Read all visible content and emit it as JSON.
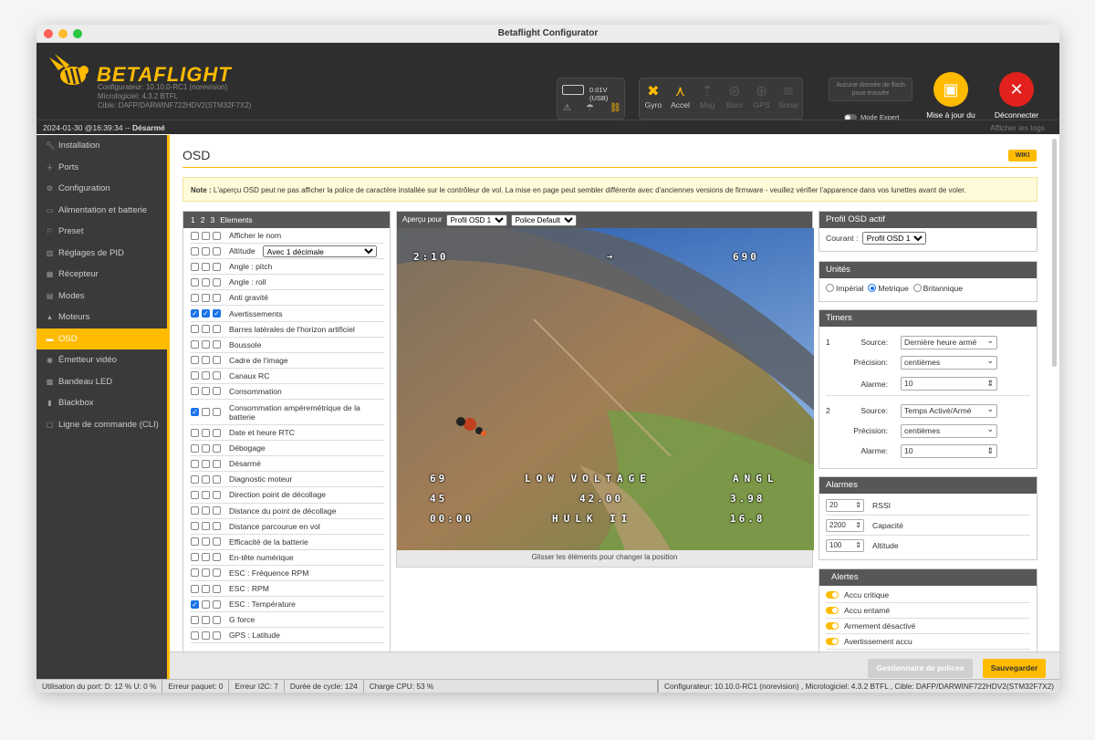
{
  "window": {
    "title": "Betaflight Configurator"
  },
  "header": {
    "brand": "BETAFLIGHT",
    "configurator": "Configurateur: 10.10.0-RC1 (norevision)",
    "firmware": "Micrologiciel: 4.3.2 BTFL",
    "target": "Cible: DAFP/DARWINF722HDV2(STM32F7X2)",
    "battery": "0.01V (USB)",
    "sensors": [
      {
        "label": "Gyro",
        "icon": "gyro-icon",
        "active": true
      },
      {
        "label": "Accel",
        "icon": "accel-icon",
        "active": true
      },
      {
        "label": "Mag",
        "icon": "mag-icon",
        "active": false
      },
      {
        "label": "Baro",
        "icon": "baro-icon",
        "active": false
      },
      {
        "label": "GPS",
        "icon": "gps-icon",
        "active": false
      },
      {
        "label": "Sonar",
        "icon": "sonar-icon",
        "active": false
      }
    ],
    "flash_line1": "Aucune donnée de flash",
    "flash_line2": "puce trouvée",
    "expert_mode": "Mode Expert",
    "update_btn_line1": "Mise à jour du",
    "update_btn_line2": "micrologiciel",
    "disconnect_btn": "Déconnecter",
    "brand_color": "#ffbb00",
    "disconnect_color": "#e2211c"
  },
  "statusline": {
    "datetime": "2024-01-30 @16:39:34 -- ",
    "state": "Désarmé",
    "show_logs": "Afficher les logs"
  },
  "sidebar": {
    "items": [
      {
        "label": "Installation",
        "icon": "wrench-icon"
      },
      {
        "label": "Ports",
        "icon": "plug-icon"
      },
      {
        "label": "Configuration",
        "icon": "gear-icon"
      },
      {
        "label": "Alimentation et batterie",
        "icon": "battery-icon"
      },
      {
        "label": "Preset",
        "icon": "preset-icon"
      },
      {
        "label": "Réglages de PID",
        "icon": "pid-icon"
      },
      {
        "label": "Récepteur",
        "icon": "receiver-icon"
      },
      {
        "label": "Modes",
        "icon": "modes-icon"
      },
      {
        "label": "Moteurs",
        "icon": "motor-icon"
      },
      {
        "label": "OSD",
        "icon": "osd-icon",
        "active": true
      },
      {
        "label": "Émetteur vidéo",
        "icon": "vtx-icon"
      },
      {
        "label": "Bandeau LED",
        "icon": "led-icon"
      },
      {
        "label": "Blackbox",
        "icon": "blackbox-icon"
      },
      {
        "label": "Ligne de commande (CLI)",
        "icon": "cli-icon"
      }
    ]
  },
  "main": {
    "title": "OSD",
    "wiki": "WIKI",
    "note_bold": "Note :",
    "note_text": " L'aperçu OSD peut ne pas afficher la police de caractère installée sur le contrôleur de vol. La mise en page peut sembler différente avec d'anciennes versions de firmware - veuillez vérifier l'apparence dans vos lunettes avant de voler."
  },
  "elements": {
    "header": {
      "p1": "1",
      "p2": "2",
      "p3": "3",
      "title": "Elements"
    },
    "rows": [
      {
        "label": "Afficher le nom",
        "checks": [
          false,
          false,
          false
        ]
      },
      {
        "label": "Altitude",
        "checks": [
          false,
          false,
          false
        ],
        "select": "Avec 1 décimale"
      },
      {
        "label": "Angle : pitch",
        "checks": [
          false,
          false,
          false
        ]
      },
      {
        "label": "Angle : roll",
        "checks": [
          false,
          false,
          false
        ]
      },
      {
        "label": "Anti gravité",
        "checks": [
          false,
          false,
          false
        ]
      },
      {
        "label": "Avertissements",
        "checks": [
          true,
          true,
          true
        ]
      },
      {
        "label": "Barres latérales de l'horizon artificiel",
        "checks": [
          false,
          false,
          false
        ]
      },
      {
        "label": "Boussole",
        "checks": [
          false,
          false,
          false
        ]
      },
      {
        "label": "Cadre de l'image",
        "checks": [
          false,
          false,
          false
        ]
      },
      {
        "label": "Canaux RC",
        "checks": [
          false,
          false,
          false
        ]
      },
      {
        "label": "Consommation",
        "checks": [
          false,
          false,
          false
        ]
      },
      {
        "label": "Consommation ampèremétrique de la batterie",
        "checks": [
          true,
          false,
          false
        ],
        "tall": true
      },
      {
        "label": "Date et heure RTC",
        "checks": [
          false,
          false,
          false
        ]
      },
      {
        "label": "Débogage",
        "checks": [
          false,
          false,
          false
        ]
      },
      {
        "label": "Désarmé",
        "checks": [
          false,
          false,
          false
        ]
      },
      {
        "label": "Diagnostic moteur",
        "checks": [
          false,
          false,
          false
        ]
      },
      {
        "label": "Direction point de décollage",
        "checks": [
          false,
          false,
          false
        ]
      },
      {
        "label": "Distance du point de décollage",
        "checks": [
          false,
          false,
          false
        ]
      },
      {
        "label": "Distance parcourue en vol",
        "checks": [
          false,
          false,
          false
        ]
      },
      {
        "label": "Efficacité de la batterie",
        "checks": [
          false,
          false,
          false
        ]
      },
      {
        "label": "En-tête numérique",
        "checks": [
          false,
          false,
          false
        ]
      },
      {
        "label": "ESC : Fréquence RPM",
        "checks": [
          false,
          false,
          false
        ]
      },
      {
        "label": "ESC : RPM",
        "checks": [
          false,
          false,
          false
        ]
      },
      {
        "label": "ESC : Température",
        "checks": [
          true,
          false,
          false
        ]
      },
      {
        "label": "G force",
        "checks": [
          false,
          false,
          false
        ]
      },
      {
        "label": "GPS : Latitude",
        "checks": [
          false,
          false,
          false
        ]
      }
    ]
  },
  "preview": {
    "label": "Aperçu pour",
    "profile": "Profil OSD 1",
    "font": "Police Default",
    "footer": "Glisser les éléments pour changer la position",
    "osd": {
      "timer": "2:10",
      "mah": "690",
      "warning": "LOW VOLTAGE",
      "angl": "ANGL",
      "sats": "69",
      "temp": "45",
      "voltage": "42.00",
      "cell": "3.98",
      "fly_time": "00:00",
      "craft": "HULK II",
      "cell2": "16.8"
    }
  },
  "profile": {
    "title": "Profil OSD actif",
    "label": "Courant :",
    "value": "Profil OSD 1"
  },
  "units": {
    "title": "Unités",
    "options": [
      "Impérial",
      "Metrique",
      "Britannique"
    ],
    "selected": 1
  },
  "timers": {
    "title": "Timers",
    "list": [
      {
        "num": "1",
        "source_label": "Source:",
        "source": "Dernière heure armé",
        "precision_label": "Précision:",
        "precision": "centièmes",
        "alarm_label": "Alarme:",
        "alarm": "10"
      },
      {
        "num": "2",
        "source_label": "Source:",
        "source": "Temps Activé/Armé",
        "precision_label": "Précision:",
        "precision": "centièmes",
        "alarm_label": "Alarme:",
        "alarm": "10"
      }
    ]
  },
  "alarms": {
    "title": "Alarmes",
    "rows": [
      {
        "value": "20",
        "label": "RSSI"
      },
      {
        "value": "2200",
        "label": "Capacité"
      },
      {
        "value": "100",
        "label": "Altitude"
      }
    ]
  },
  "alerts": {
    "title": "Alertes",
    "items": [
      "Accu critique",
      "Accu entamé",
      "Armement désactivé",
      "Avertissement accu"
    ]
  },
  "footer": {
    "fonts_btn": "Gestionnaire de polices",
    "save_btn": "Sauvegarder"
  },
  "bottombar": {
    "port": "Utilisation du port: D: 12 % U: 0 %",
    "packet": "Erreur paquet: 0",
    "i2c": "Erreur I2C: 7",
    "cycle": "Durée de cycle: 124",
    "cpu": "Charge CPU: 53 %",
    "version": "Configurateur: 10.10.0-RC1 (norevision) , Micrologiciel: 4.3.2 BTFL , Cible: DAFP/DARWINF722HDV2(STM32F7X2)"
  }
}
